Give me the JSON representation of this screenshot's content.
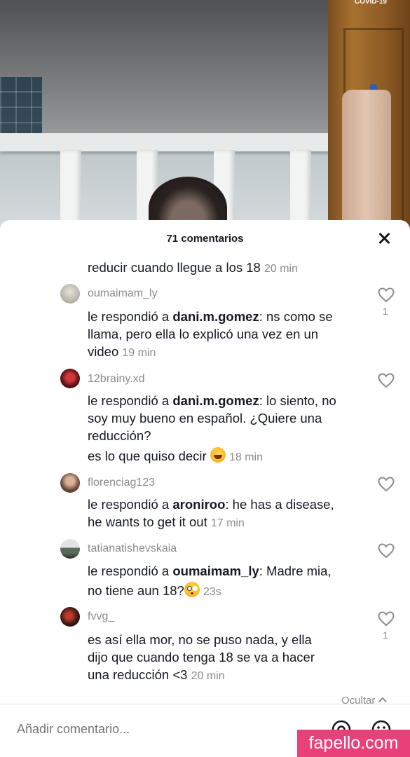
{
  "overlay": {
    "covid_tag": "COVID-19"
  },
  "sheet": {
    "title": "71 comentarios"
  },
  "comments": [
    {
      "lines": [
        "reducir cuando llegue a los 18"
      ],
      "time": "20 min"
    },
    {
      "username": "oumaimam_ly",
      "reply_prefix": "le respondió a ",
      "reply_to": "dani.m.gomez",
      "lines": [
        ": ns como se",
        "llama, pero ella lo explicó una vez en un",
        "video"
      ],
      "time": "19 min",
      "likes": "1"
    },
    {
      "username": "12brainy.xd",
      "reply_prefix": "le respondió a ",
      "reply_to": "dani.m.gomez",
      "lines": [
        ": lo siento, no",
        "soy muy bueno en español. ¿Quiere una",
        "reducción?",
        "es lo que quiso decir"
      ],
      "emoji": "laughing-emoji",
      "time": "18 min"
    },
    {
      "username": "florenciag123",
      "reply_prefix": "le respondió a ",
      "reply_to": "aroniroo",
      "lines": [
        ": he has a disease,",
        "he wants to get it out"
      ],
      "time": "17 min"
    },
    {
      "username": "tatianatishevskaia",
      "reply_prefix": "le respondió a ",
      "reply_to": "oumaimam_ly",
      "lines": [
        ": Madre mia,",
        "no tiene aun 18?"
      ],
      "emoji": "flushed-emoji",
      "time": "23s"
    },
    {
      "username": "fvvg_",
      "lines": [
        "es así ella mor, no se puso nada, y ella",
        "dijo que cuando tenga 18 se va a hacer",
        "una reducción <3"
      ],
      "time": "20 min",
      "likes": "1"
    }
  ],
  "footer": {
    "hide_label": "Ocultar",
    "input_placeholder": "Añadir comentario...",
    "icons": [
      "at-icon",
      "emoji-icon"
    ]
  },
  "watermark": "fapello.com"
}
